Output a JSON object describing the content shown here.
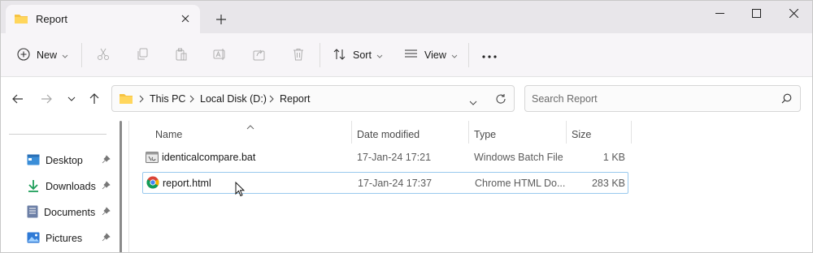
{
  "window": {
    "tab_title": "Report",
    "tab_icon": "folder-icon",
    "new_tab": "+",
    "controls": [
      "minimize-icon",
      "maximize-icon",
      "close-icon"
    ]
  },
  "commandbar": {
    "new_label": "New",
    "sort_label": "Sort",
    "view_label": "View",
    "more_label": "...",
    "icons": [
      "cut-icon",
      "copy-icon",
      "paste-icon",
      "rename-icon",
      "share-icon",
      "delete-icon"
    ]
  },
  "address": {
    "crumbs": [
      "This PC",
      "Local Disk (D:)",
      "Report"
    ],
    "search_placeholder": "Search Report"
  },
  "nav": {
    "items": [
      {
        "label": "Desktop",
        "icon": "desktop-icon"
      },
      {
        "label": "Downloads",
        "icon": "downloads-icon"
      },
      {
        "label": "Documents",
        "icon": "documents-icon"
      },
      {
        "label": "Pictures",
        "icon": "pictures-icon"
      }
    ]
  },
  "columns": {
    "name": "Name",
    "date": "Date modified",
    "type": "Type",
    "size": "Size"
  },
  "files": [
    {
      "name": "identicalcompare.bat",
      "date": "17-Jan-24 17:21",
      "type": "Windows Batch File",
      "size": "1 KB",
      "icon": "batch-file-icon"
    },
    {
      "name": "report.html",
      "date": "17-Jan-24 17:37",
      "type": "Chrome HTML Do...",
      "size": "283 KB",
      "icon": "chrome-icon",
      "selected": true
    }
  ],
  "colors": {
    "titlebar": "#e8e6ea",
    "folder": "#f6c343",
    "selection_border": "#99c9ee"
  }
}
